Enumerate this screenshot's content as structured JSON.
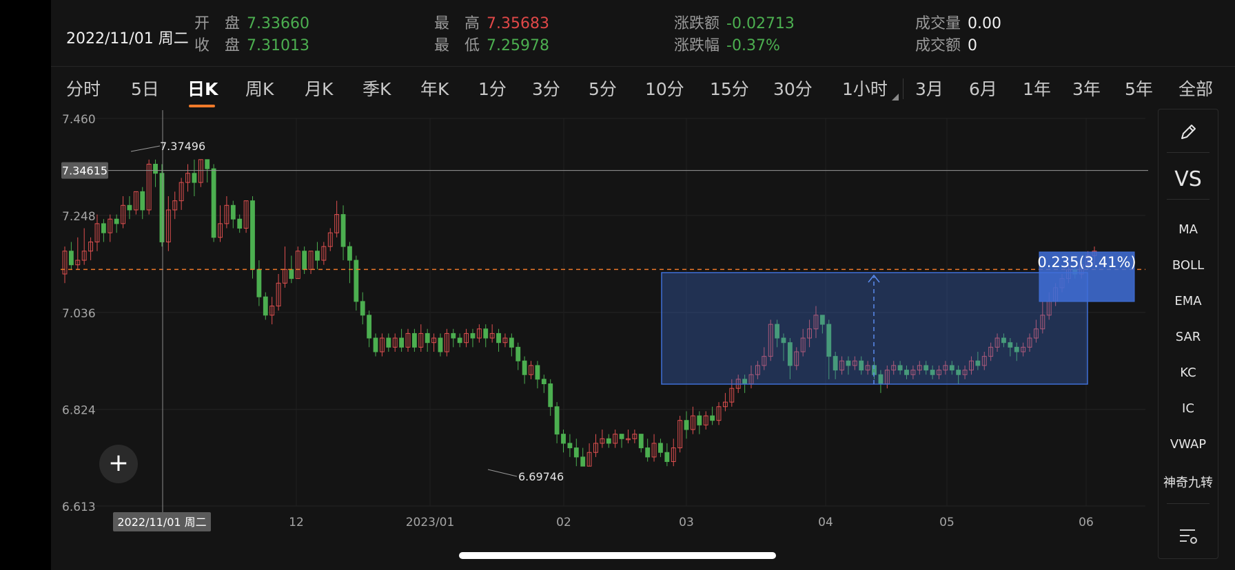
{
  "header": {
    "date": "2022/11/01 周二",
    "open": {
      "label": "开　盘",
      "value": "7.33660"
    },
    "close": {
      "label": "收　盘",
      "value": "7.31013"
    },
    "high": {
      "label": "最　高",
      "value": "7.35683"
    },
    "low": {
      "label": "最　低",
      "value": "7.25978"
    },
    "change": {
      "label": "涨跌额",
      "value": "-0.02713"
    },
    "change_pct": {
      "label": "涨跌幅",
      "value": "-0.37%"
    },
    "volume": {
      "label": "成交量",
      "value": "0.00"
    },
    "amount": {
      "label": "成交额",
      "value": "0"
    }
  },
  "tabs": [
    "分时",
    "5日",
    "日K",
    "周K",
    "月K",
    "季K",
    "年K",
    "1分",
    "3分",
    "5分",
    "10分",
    "15分",
    "30分",
    "1小时",
    "3月",
    "6月",
    "1年",
    "3年",
    "5年",
    "全部"
  ],
  "active_tab": "日K",
  "toolbar": {
    "items": [
      "MA",
      "BOLL",
      "EMA",
      "SAR",
      "KC",
      "IC",
      "VWAP",
      "神奇九转"
    ],
    "vs_label": "VS",
    "icons": [
      "pencil-icon",
      "settings-list-icon"
    ]
  },
  "chart_data": {
    "type": "candlestick",
    "y_ticks": [
      "7.460",
      "7.248",
      "7.036",
      "6.824",
      "6.613"
    ],
    "x_ticks": [
      "12",
      "2023/01",
      "02",
      "03",
      "04",
      "05",
      "06"
    ],
    "crosshair_price": "7.34615",
    "crosshair_date": "2022/11/01 周二",
    "max_label": "7.37496",
    "min_label": "6.69746",
    "measure_label": "0.235(3.41%)",
    "reference_line": 7.13,
    "colors": {
      "up": "#e05050",
      "down": "#4caf50",
      "ref": "#f07a2a",
      "box": "#3f6fd8"
    },
    "ylim": [
      6.613,
      7.46
    ],
    "candles": [
      [
        7.12,
        7.17,
        7.1,
        7.18
      ],
      [
        7.17,
        7.14,
        7.13,
        7.19
      ],
      [
        7.14,
        7.15,
        7.13,
        7.2
      ],
      [
        7.15,
        7.17,
        7.14,
        7.22
      ],
      [
        7.17,
        7.19,
        7.15,
        7.2
      ],
      [
        7.19,
        7.23,
        7.17,
        7.25
      ],
      [
        7.23,
        7.21,
        7.19,
        7.24
      ],
      [
        7.21,
        7.24,
        7.19,
        7.25
      ],
      [
        7.24,
        7.23,
        7.21,
        7.25
      ],
      [
        7.23,
        7.27,
        7.22,
        7.29
      ],
      [
        7.27,
        7.26,
        7.24,
        7.29
      ],
      [
        7.26,
        7.3,
        7.25,
        7.3
      ],
      [
        7.3,
        7.26,
        7.24,
        7.31
      ],
      [
        7.26,
        7.36,
        7.25,
        7.37
      ],
      [
        7.36,
        7.34,
        7.31,
        7.37
      ],
      [
        7.34,
        7.19,
        7.18,
        7.36
      ],
      [
        7.19,
        7.26,
        7.17,
        7.29
      ],
      [
        7.26,
        7.28,
        7.24,
        7.3
      ],
      [
        7.28,
        7.32,
        7.26,
        7.33
      ],
      [
        7.32,
        7.34,
        7.3,
        7.36
      ],
      [
        7.34,
        7.32,
        7.29,
        7.37
      ],
      [
        7.32,
        7.37,
        7.31,
        7.37
      ],
      [
        7.37,
        7.35,
        7.32,
        7.37
      ],
      [
        7.35,
        7.2,
        7.19,
        7.36
      ],
      [
        7.2,
        7.23,
        7.19,
        7.27
      ],
      [
        7.23,
        7.27,
        7.22,
        7.29
      ],
      [
        7.27,
        7.24,
        7.22,
        7.28
      ],
      [
        7.24,
        7.22,
        7.21,
        7.25
      ],
      [
        7.22,
        7.28,
        7.21,
        7.28
      ],
      [
        7.28,
        7.13,
        7.11,
        7.29
      ],
      [
        7.13,
        7.07,
        7.05,
        7.15
      ],
      [
        7.07,
        7.03,
        7.02,
        7.08
      ],
      [
        7.03,
        7.05,
        7.01,
        7.07
      ],
      [
        7.05,
        7.1,
        7.04,
        7.12
      ],
      [
        7.1,
        7.13,
        7.09,
        7.18
      ],
      [
        7.13,
        7.11,
        7.1,
        7.16
      ],
      [
        7.11,
        7.17,
        7.11,
        7.18
      ],
      [
        7.17,
        7.13,
        7.12,
        7.18
      ],
      [
        7.13,
        7.17,
        7.12,
        7.17
      ],
      [
        7.17,
        7.15,
        7.13,
        7.19
      ],
      [
        7.15,
        7.18,
        7.14,
        7.19
      ],
      [
        7.18,
        7.21,
        7.17,
        7.22
      ],
      [
        7.21,
        7.25,
        7.2,
        7.28
      ],
      [
        7.25,
        7.18,
        7.15,
        7.27
      ],
      [
        7.18,
        7.15,
        7.1,
        7.19
      ],
      [
        7.15,
        7.06,
        7.04,
        7.16
      ],
      [
        7.06,
        7.03,
        7.01,
        7.08
      ],
      [
        7.03,
        6.98,
        6.96,
        7.04
      ],
      [
        6.98,
        6.95,
        6.94,
        6.99
      ],
      [
        6.95,
        6.98,
        6.94,
        6.99
      ],
      [
        6.98,
        6.96,
        6.95,
        6.99
      ],
      [
        6.96,
        6.98,
        6.95,
        6.99
      ],
      [
        6.98,
        6.96,
        6.95,
        7.0
      ],
      [
        6.96,
        6.99,
        6.95,
        7.0
      ],
      [
        6.99,
        6.96,
        6.95,
        7.0
      ],
      [
        6.96,
        6.99,
        6.95,
        7.01
      ],
      [
        6.99,
        6.97,
        6.95,
        7.0
      ],
      [
        6.97,
        6.98,
        6.95,
        6.99
      ],
      [
        6.98,
        6.95,
        6.94,
        6.99
      ],
      [
        6.95,
        6.99,
        6.94,
        7.0
      ],
      [
        6.99,
        6.98,
        6.96,
        7.0
      ],
      [
        6.98,
        6.97,
        6.96,
        6.99
      ],
      [
        6.97,
        6.99,
        6.96,
        7.0
      ],
      [
        6.99,
        6.98,
        6.96,
        7.0
      ],
      [
        6.98,
        7.0,
        6.97,
        7.01
      ],
      [
        7.0,
        6.98,
        6.96,
        7.01
      ],
      [
        6.98,
        6.99,
        6.97,
        7.01
      ],
      [
        6.99,
        6.97,
        6.95,
        7.0
      ],
      [
        6.97,
        6.98,
        6.96,
        6.99
      ],
      [
        6.98,
        6.96,
        6.94,
        6.99
      ],
      [
        6.96,
        6.93,
        6.91,
        6.97
      ],
      [
        6.93,
        6.9,
        6.88,
        6.94
      ],
      [
        6.9,
        6.92,
        6.89,
        6.93
      ],
      [
        6.92,
        6.89,
        6.87,
        6.93
      ],
      [
        6.89,
        6.88,
        6.86,
        6.9
      ],
      [
        6.88,
        6.83,
        6.81,
        6.89
      ],
      [
        6.83,
        6.77,
        6.75,
        6.84
      ],
      [
        6.77,
        6.75,
        6.73,
        6.78
      ],
      [
        6.75,
        6.74,
        6.72,
        6.77
      ],
      [
        6.74,
        6.72,
        6.7,
        6.76
      ],
      [
        6.72,
        6.7,
        6.7,
        6.74
      ],
      [
        6.7,
        6.73,
        6.7,
        6.75
      ],
      [
        6.73,
        6.75,
        6.72,
        6.77
      ],
      [
        6.75,
        6.76,
        6.74,
        6.78
      ],
      [
        6.76,
        6.75,
        6.74,
        6.77
      ],
      [
        6.75,
        6.77,
        6.74,
        6.78
      ],
      [
        6.77,
        6.76,
        6.74,
        6.77
      ],
      [
        6.76,
        6.76,
        6.75,
        6.78
      ],
      [
        6.76,
        6.77,
        6.75,
        6.78
      ],
      [
        6.77,
        6.74,
        6.73,
        6.77
      ],
      [
        6.74,
        6.72,
        6.71,
        6.76
      ],
      [
        6.72,
        6.75,
        6.71,
        6.77
      ],
      [
        6.75,
        6.73,
        6.72,
        6.76
      ],
      [
        6.73,
        6.71,
        6.7,
        6.75
      ],
      [
        6.71,
        6.74,
        6.7,
        6.76
      ],
      [
        6.74,
        6.8,
        6.73,
        6.81
      ],
      [
        6.8,
        6.78,
        6.76,
        6.82
      ],
      [
        6.78,
        6.81,
        6.77,
        6.83
      ],
      [
        6.81,
        6.79,
        6.77,
        6.82
      ],
      [
        6.79,
        6.81,
        6.78,
        6.82
      ],
      [
        6.81,
        6.8,
        6.79,
        6.83
      ],
      [
        6.8,
        6.83,
        6.79,
        6.84
      ],
      [
        6.83,
        6.84,
        6.82,
        6.86
      ],
      [
        6.84,
        6.87,
        6.83,
        6.89
      ],
      [
        6.87,
        6.89,
        6.86,
        6.9
      ],
      [
        6.89,
        6.88,
        6.86,
        6.9
      ],
      [
        6.88,
        6.9,
        6.87,
        6.92
      ],
      [
        6.9,
        6.92,
        6.89,
        6.93
      ],
      [
        6.92,
        6.94,
        6.91,
        6.96
      ],
      [
        6.94,
        7.01,
        6.93,
        7.02
      ],
      [
        7.01,
        6.98,
        6.96,
        7.02
      ],
      [
        6.98,
        6.97,
        6.93,
        6.99
      ],
      [
        6.97,
        6.92,
        6.89,
        6.98
      ],
      [
        6.92,
        6.95,
        6.91,
        6.96
      ],
      [
        6.95,
        6.98,
        6.94,
        7.0
      ],
      [
        6.98,
        7.0,
        6.96,
        7.02
      ],
      [
        7.0,
        7.03,
        6.98,
        7.05
      ],
      [
        7.03,
        7.01,
        6.99,
        7.03
      ],
      [
        7.01,
        6.94,
        6.89,
        7.02
      ],
      [
        6.94,
        6.91,
        6.89,
        6.95
      ],
      [
        6.91,
        6.93,
        6.9,
        6.94
      ],
      [
        6.93,
        6.92,
        6.9,
        6.94
      ],
      [
        6.92,
        6.93,
        6.91,
        6.94
      ],
      [
        6.93,
        6.91,
        6.9,
        6.94
      ],
      [
        6.91,
        6.92,
        6.9,
        6.93
      ],
      [
        6.92,
        6.9,
        6.89,
        6.93
      ],
      [
        6.9,
        6.88,
        6.86,
        6.91
      ],
      [
        6.88,
        6.91,
        6.87,
        6.92
      ],
      [
        6.91,
        6.92,
        6.9,
        6.93
      ],
      [
        6.92,
        6.91,
        6.9,
        6.93
      ],
      [
        6.91,
        6.9,
        6.89,
        6.92
      ],
      [
        6.9,
        6.91,
        6.89,
        6.92
      ],
      [
        6.91,
        6.92,
        6.9,
        6.93
      ],
      [
        6.92,
        6.91,
        6.9,
        6.93
      ],
      [
        6.91,
        6.9,
        6.89,
        6.92
      ],
      [
        6.9,
        6.91,
        6.89,
        6.92
      ],
      [
        6.91,
        6.92,
        6.9,
        6.93
      ],
      [
        6.92,
        6.91,
        6.9,
        6.93
      ],
      [
        6.91,
        6.9,
        6.88,
        6.92
      ],
      [
        6.9,
        6.91,
        6.89,
        6.92
      ],
      [
        6.91,
        6.93,
        6.9,
        6.94
      ],
      [
        6.93,
        6.92,
        6.91,
        6.95
      ],
      [
        6.92,
        6.94,
        6.91,
        6.95
      ],
      [
        6.94,
        6.96,
        6.93,
        6.97
      ],
      [
        6.96,
        6.98,
        6.95,
        6.99
      ],
      [
        6.98,
        6.97,
        6.96,
        6.99
      ],
      [
        6.97,
        6.96,
        6.94,
        6.98
      ],
      [
        6.96,
        6.95,
        6.93,
        6.97
      ],
      [
        6.95,
        6.96,
        6.94,
        6.97
      ],
      [
        6.96,
        6.98,
        6.95,
        6.99
      ],
      [
        6.98,
        7.0,
        6.97,
        7.02
      ],
      [
        7.0,
        7.03,
        6.99,
        7.06
      ],
      [
        7.03,
        7.06,
        7.02,
        7.08
      ],
      [
        7.06,
        7.09,
        7.05,
        7.1
      ],
      [
        7.09,
        7.11,
        7.08,
        7.12
      ],
      [
        7.11,
        7.13,
        7.1,
        7.14
      ],
      [
        7.13,
        7.12,
        7.11,
        7.14
      ],
      [
        7.12,
        7.14,
        7.11,
        7.15
      ],
      [
        7.14,
        7.16,
        7.13,
        7.17
      ],
      [
        7.16,
        7.17,
        7.14,
        7.18
      ]
    ]
  }
}
